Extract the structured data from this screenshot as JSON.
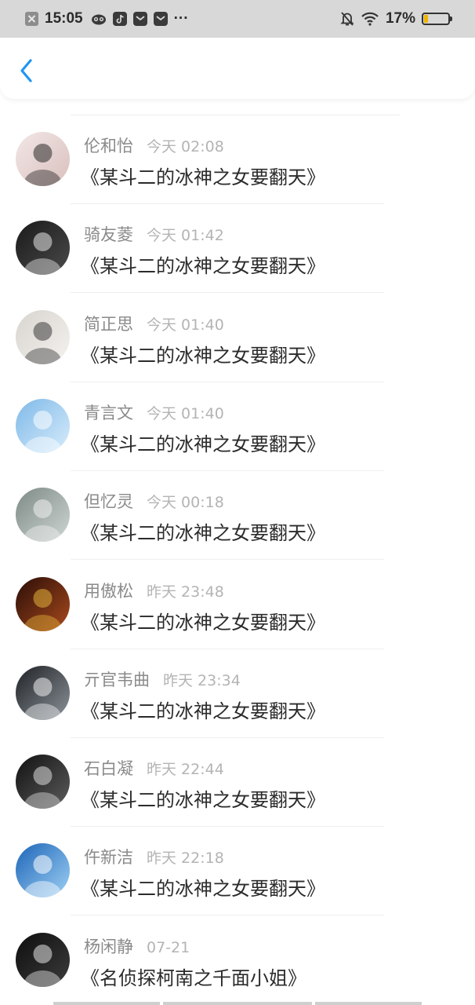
{
  "status_bar": {
    "time": "15:05",
    "battery_percent": "17%",
    "battery_level": 0.17,
    "more_glyph": "···",
    "icons": [
      "close-notification-icon",
      "owl-app-icon",
      "tiktok-icon",
      "messenger-icon",
      "messenger-icon",
      "mute-icon",
      "wifi-icon",
      "battery-icon"
    ]
  },
  "navbar": {
    "back_icon": "chevron-left-icon",
    "accent": "#2196f3"
  },
  "items": [
    {
      "name": "伦和怡",
      "time": "今天 02:08",
      "title": "《某斗二的冰神之女要翻天》",
      "avatar": {
        "bg": [
          "#f2e7e6",
          "#d9c0bd"
        ],
        "fg": "#2a2a2a"
      }
    },
    {
      "name": "骑友菱",
      "time": "今天 01:42",
      "title": "《某斗二的冰神之女要翻天》",
      "avatar": {
        "bg": [
          "#1a1a1a",
          "#4a4a4a"
        ],
        "fg": "#e8e8e8"
      }
    },
    {
      "name": "简正思",
      "time": "今天 01:40",
      "title": "《某斗二的冰神之女要翻天》",
      "avatar": {
        "bg": [
          "#d8d4cf",
          "#f4f2ef"
        ],
        "fg": "#3b3b3b"
      }
    },
    {
      "name": "青言文",
      "time": "今天 01:40",
      "title": "《某斗二的冰神之女要翻天》",
      "avatar": {
        "bg": [
          "#7fb9e8",
          "#d7ecfb"
        ],
        "fg": "#ffffff"
      }
    },
    {
      "name": "但忆灵",
      "time": "今天 00:18",
      "title": "《某斗二的冰神之女要翻天》",
      "avatar": {
        "bg": [
          "#7d8a86",
          "#cfd6d2"
        ],
        "fg": "#f0f0f0"
      }
    },
    {
      "name": "用傲松",
      "time": "昨天 23:48",
      "title": "《某斗二的冰神之女要翻天》",
      "avatar": {
        "bg": [
          "#2a0d08",
          "#a84a1c"
        ],
        "fg": "#e2b23a"
      }
    },
    {
      "name": "亓官韦曲",
      "time": "昨天 23:34",
      "title": "《某斗二的冰神之女要翻天》",
      "avatar": {
        "bg": [
          "#1f2226",
          "#8c939a"
        ],
        "fg": "#f1f1f1"
      }
    },
    {
      "name": "石白凝",
      "time": "昨天 22:44",
      "title": "《某斗二的冰神之女要翻天》",
      "avatar": {
        "bg": [
          "#111111",
          "#5c5c5c"
        ],
        "fg": "#dcdcdc"
      }
    },
    {
      "name": "仵新洁",
      "time": "昨天 22:18",
      "title": "《某斗二的冰神之女要翻天》",
      "avatar": {
        "bg": [
          "#1c65b8",
          "#9fd0f4"
        ],
        "fg": "#ffffff"
      }
    },
    {
      "name": "杨闲静",
      "time": "07-21",
      "title": "《名侦探柯南之千面小姐》",
      "avatar": {
        "bg": [
          "#0e0e0e",
          "#3c3c3c"
        ],
        "fg": "#e6e6e6"
      }
    }
  ]
}
